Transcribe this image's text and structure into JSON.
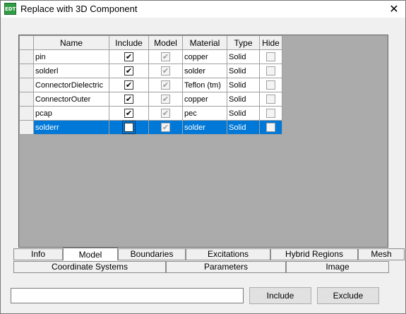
{
  "window": {
    "icon_text": "EDT",
    "title": "Replace with 3D Component",
    "close_glyph": "✕"
  },
  "grid": {
    "columns": [
      "Name",
      "Include",
      "Model",
      "Material",
      "Type",
      "Hide"
    ],
    "rows": [
      {
        "name": "pin",
        "include": true,
        "model": true,
        "material": "copper",
        "type": "Solid",
        "hide": false
      },
      {
        "name": "solderl",
        "include": true,
        "model": true,
        "material": "solder",
        "type": "Solid",
        "hide": false
      },
      {
        "name": "ConnectorDielectric",
        "include": true,
        "model": true,
        "material": "Teflon (tm)",
        "type": "Solid",
        "hide": false
      },
      {
        "name": "ConnectorOuter",
        "include": true,
        "model": true,
        "material": "copper",
        "type": "Solid",
        "hide": false
      },
      {
        "name": "pcap",
        "include": true,
        "model": true,
        "material": "pec",
        "type": "Solid",
        "hide": false
      },
      {
        "name": "solderr",
        "include": false,
        "model": true,
        "material": "solder",
        "type": "Solid",
        "hide": false,
        "selected": true
      }
    ]
  },
  "tabs_row1": [
    "Info",
    "Model",
    "Boundaries",
    "Excitations",
    "Hybrid Regions",
    "Mesh"
  ],
  "tabs_row2": [
    "Coordinate Systems",
    "Parameters",
    "Image"
  ],
  "active_tab": "Model",
  "bottom": {
    "input_value": "",
    "include_label": "Include",
    "exclude_label": "Exclude"
  },
  "colors": {
    "selection": "#0078d7",
    "app_icon": "#2f9e44"
  }
}
